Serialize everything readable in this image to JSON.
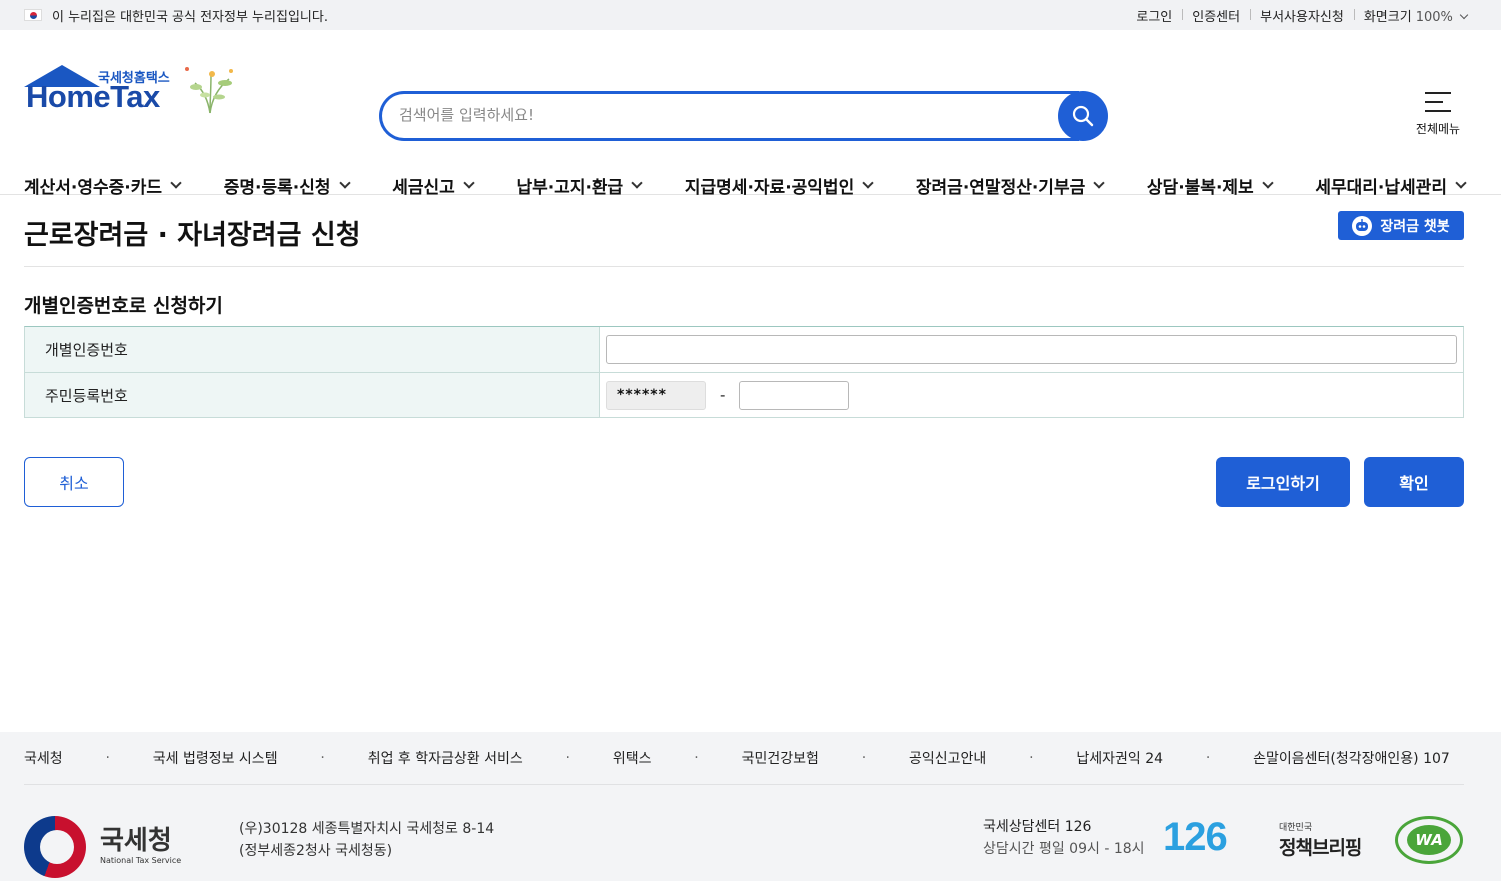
{
  "govbar": {
    "notice": "이 누리집은 대한민국 공식 전자정부 누리집입니다.",
    "links": [
      "로그인",
      "인증센터",
      "부서사용자신청"
    ],
    "zoom_label": "화면크기",
    "zoom_value": "100%"
  },
  "header": {
    "logo_sub": "국세청홈택스",
    "logo_main": "HomeTax",
    "search_placeholder": "검색어를 입력하세요!",
    "all_menu": "전체메뉴",
    "nav": [
      "계산서·영수증·카드",
      "증명·등록·신청",
      "세금신고",
      "납부·고지·환급",
      "지급명세·자료·공익법인",
      "장려금·연말정산·기부금",
      "상담·불복·제보",
      "세무대리·납세관리"
    ]
  },
  "content": {
    "page_title": "근로장려금 · 자녀장려금 신청",
    "chatbot": "장려금 챗봇",
    "section_title": "개별인증번호로 신청하기",
    "row1_label": "개별인증번호",
    "row1_value": "",
    "row2_label": "주민등록번호",
    "ssn_front": "******",
    "ssn_dash": "-",
    "ssn_back": "",
    "btn_cancel": "취소",
    "btn_login": "로그인하기",
    "btn_ok": "확인"
  },
  "footer": {
    "links": [
      "국세청",
      "국세 법령정보 시스템",
      "취업 후 학자금상환 서비스",
      "위택스",
      "국민건강보험",
      "공익신고안내",
      "납세자권익 24",
      "손말이음센터(청각장애인용) 107"
    ],
    "org_ko": "국세청",
    "org_en": "National Tax Service",
    "address1": "(우)30128 세종특별자치시 국세청로 8-14",
    "address2": "(정부세종2청사 국세청동)",
    "center_name": "국세상담센터 126",
    "center_hours": "상담시간 평일 09시 - 18시",
    "badge_126": "126",
    "policy_small": "대한민국",
    "policy_big": "정책브리핑",
    "wa_text": "WA"
  },
  "colors": {
    "primary": "#1f5fd6",
    "table_header_bg": "#eef6f5",
    "footer_bg": "#f3f4f6"
  },
  "icons": {
    "search": "magnifier-icon",
    "menu": "hamburger-icon",
    "chatbot": "bot-icon"
  }
}
